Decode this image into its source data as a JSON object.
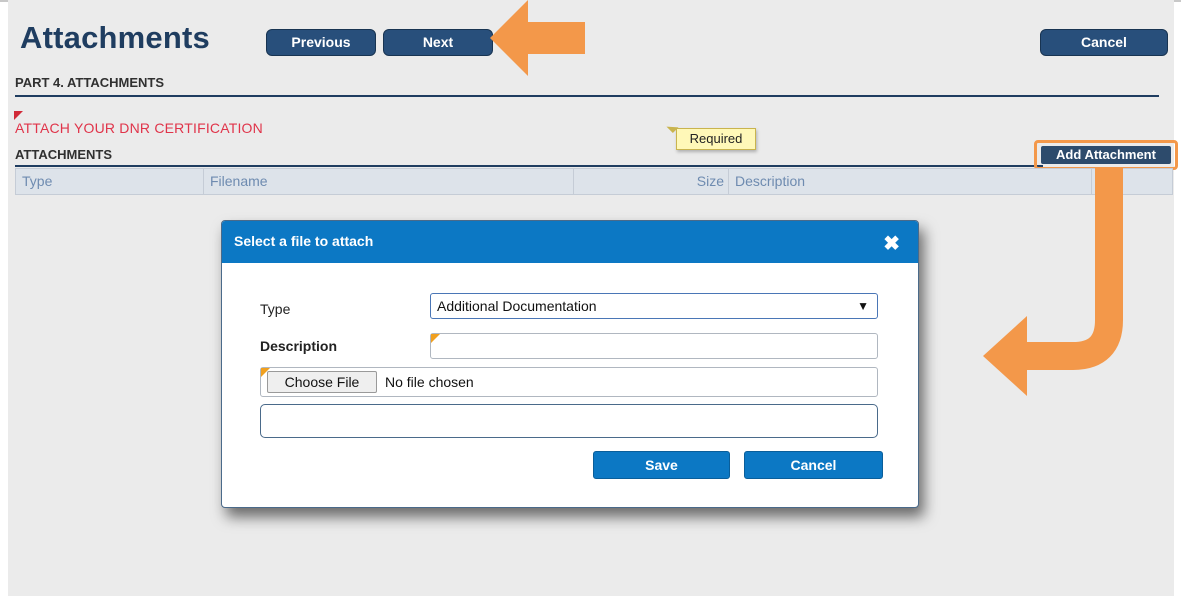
{
  "header": {
    "title": "Attachments",
    "previous_label": "Previous",
    "next_label": "Next",
    "cancel_label": "Cancel"
  },
  "section": {
    "part_title": "PART 4. ATTACHMENTS",
    "required_prompt": "ATTACH YOUR DNR CERTIFICATION",
    "attachments_title": "ATTACHMENTS",
    "add_attachment_label": "Add Attachment"
  },
  "table": {
    "columns": [
      "Type",
      "Filename",
      "Size",
      "Description"
    ]
  },
  "dialog": {
    "title": "Select a file to attach",
    "close_glyph": "✖",
    "type_label": "Type",
    "type_value": "Additional Documentation",
    "type_arrow": "▼",
    "description_label": "Description",
    "description_value": "",
    "required_tooltip": "Required",
    "choose_file_label": "Choose File",
    "file_status": "No file chosen",
    "save_label": "Save",
    "cancel_label": "Cancel"
  },
  "colors": {
    "header_blue": "#0c78c4",
    "nav_button": "#284f7b",
    "callout_orange": "#f3984a",
    "required_red": "#e0344a"
  }
}
